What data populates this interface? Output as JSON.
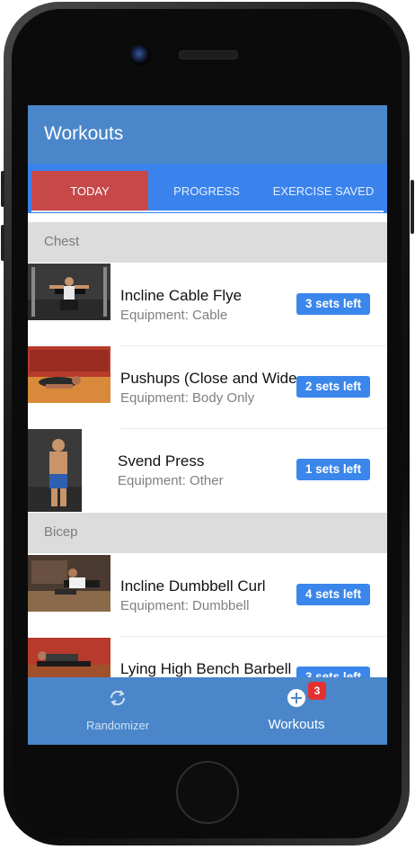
{
  "app": {
    "title": "Workouts"
  },
  "tabs": [
    {
      "label": "TODAY",
      "active": true
    },
    {
      "label": "PROGRESS",
      "active": false
    },
    {
      "label": "EXERCISE SAVED",
      "active": false
    }
  ],
  "sections": [
    {
      "title": "Chest",
      "exercises": [
        {
          "name": "Incline Cable Flye",
          "equipment": "Equipment: Cable",
          "sets_left": "3 sets left"
        },
        {
          "name": "Pushups (Close and Wide",
          "equipment": "Equipment: Body Only",
          "sets_left": "2 sets left"
        },
        {
          "name": "Svend Press",
          "equipment": "Equipment: Other",
          "sets_left": "1 sets left"
        }
      ]
    },
    {
      "title": "Bicep",
      "exercises": [
        {
          "name": "Incline Dumbbell Curl",
          "equipment": "Equipment: Dumbbell",
          "sets_left": "4 sets left"
        },
        {
          "name": "Lying High Bench Barbell",
          "equipment": "",
          "sets_left": "3 sets left"
        }
      ]
    }
  ],
  "bottom_nav": [
    {
      "label": "Randomizer",
      "icon": "refresh-icon",
      "active": false
    },
    {
      "label": "Workouts",
      "icon": "add-circle-icon",
      "active": true,
      "badge": "3"
    }
  ],
  "colors": {
    "appbar": "#4a86c9",
    "tabbar": "#3a83ec",
    "active_tab": "#c64848",
    "badge": "#3a86ea",
    "notification": "#e53030"
  }
}
